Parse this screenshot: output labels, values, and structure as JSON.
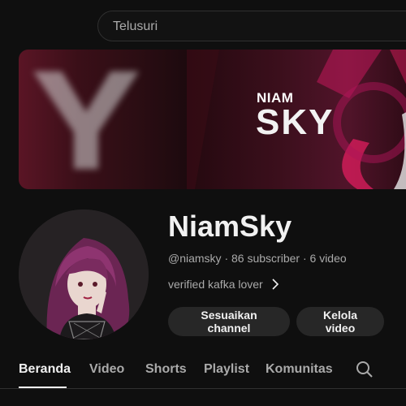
{
  "search": {
    "placeholder": "Telusuri"
  },
  "banner": {
    "line1": "NIAM",
    "line2": "SKY"
  },
  "channel": {
    "name": "NiamSky",
    "handle": "@niamsky",
    "subscribers": "86 subscriber",
    "videos": "6 video",
    "separator": " · ",
    "bio": "verified kafka lover"
  },
  "buttons": {
    "customize": "Sesuaikan channel",
    "manage": "Kelola video"
  },
  "tabs": [
    {
      "label": "Beranda",
      "active": true
    },
    {
      "label": "Video",
      "active": false
    },
    {
      "label": "Shorts",
      "active": false
    },
    {
      "label": "Playlist",
      "active": false
    },
    {
      "label": "Komunitas",
      "active": false
    }
  ],
  "icons": {
    "search": "search-icon",
    "bio_more": "chevron-right-icon"
  },
  "colors": {
    "background": "#0f0f0f",
    "text_primary": "#f1f1f1",
    "text_secondary": "#aaaaaa",
    "button_bg": "#272727",
    "banner_accent": "#d6336c"
  }
}
